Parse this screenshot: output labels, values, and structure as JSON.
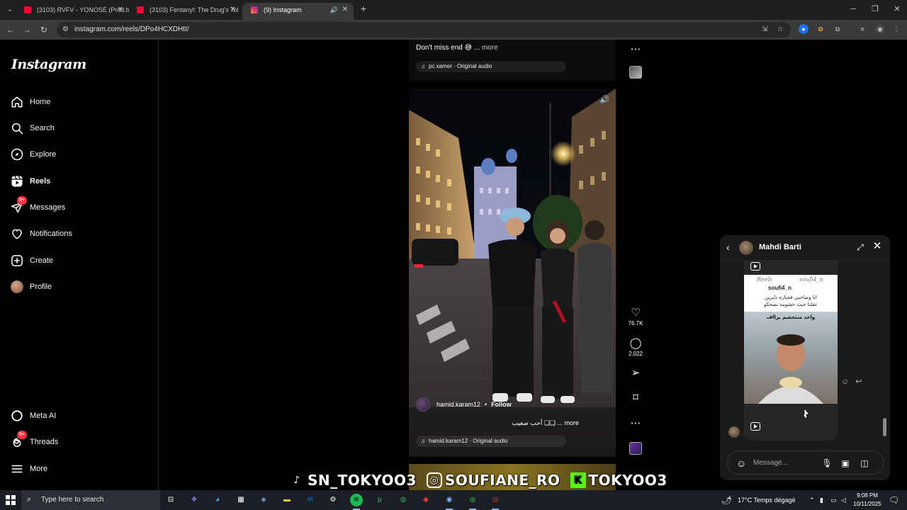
{
  "browser": {
    "tabs": [
      {
        "title": "(3103) RVFV - YONOSÉ (Prod.b",
        "favicon_color": "#ff0033"
      },
      {
        "title": "(3103) Fentanyl: The Drug's Tol",
        "favicon_color": "#ff0033"
      },
      {
        "title": "(9) Instagram",
        "favicon_color": "#e1306c"
      }
    ],
    "new_tab_label": "+",
    "url": "instagram.com/reels/DPo4HCXDHtI/"
  },
  "sidebar": {
    "logo": "Instagram",
    "items": [
      {
        "label": "Home",
        "icon": "home-icon"
      },
      {
        "label": "Search",
        "icon": "search-icon"
      },
      {
        "label": "Explore",
        "icon": "explore-icon"
      },
      {
        "label": "Reels",
        "icon": "reels-icon"
      },
      {
        "label": "Messages",
        "icon": "messages-icon",
        "badge": "9+"
      },
      {
        "label": "Notifications",
        "icon": "heart-icon"
      },
      {
        "label": "Create",
        "icon": "create-icon"
      },
      {
        "label": "Profile",
        "icon": "avatar"
      }
    ],
    "bottom_items": [
      {
        "label": "Meta AI",
        "icon": "meta-ai-icon"
      },
      {
        "label": "Threads",
        "icon": "threads-icon",
        "badge": "9+"
      },
      {
        "label": "More",
        "icon": "menu-icon"
      }
    ]
  },
  "reel_top": {
    "caption": "Don't miss end 😅 ...",
    "more": "more",
    "audio": "pc.xamer · Original audio"
  },
  "reel_main": {
    "author": "hamid.karam12",
    "follow": "Follow",
    "caption": "أحب صعيب ❑❑ ... more",
    "audio": "hamid.karam12 · Original audio",
    "likes": "76.7K",
    "comments": "2,022"
  },
  "overlay": {
    "tiktok": "SN_TOKYOO3",
    "instagram": "SOUFIANE_RO",
    "kick": "TOKYOO3"
  },
  "chat": {
    "name": "Mahdi Barti",
    "shared": {
      "reels_label": "Reels",
      "user_top": "soufi4_n",
      "username": "soufi4_n",
      "arabic_line1": "انا وصاحبي فجنازة دايرين",
      "arabic_line2": "عقلنا حيث حشومة نضحكو",
      "arabic_line3": "واحد منتحشم بزااف"
    },
    "input_placeholder": "Message..."
  },
  "taskbar": {
    "search_text": "Type here to search",
    "weather": "17°C  Temps dégagé",
    "time": "9:08 PM",
    "date": "10/11/2025"
  }
}
